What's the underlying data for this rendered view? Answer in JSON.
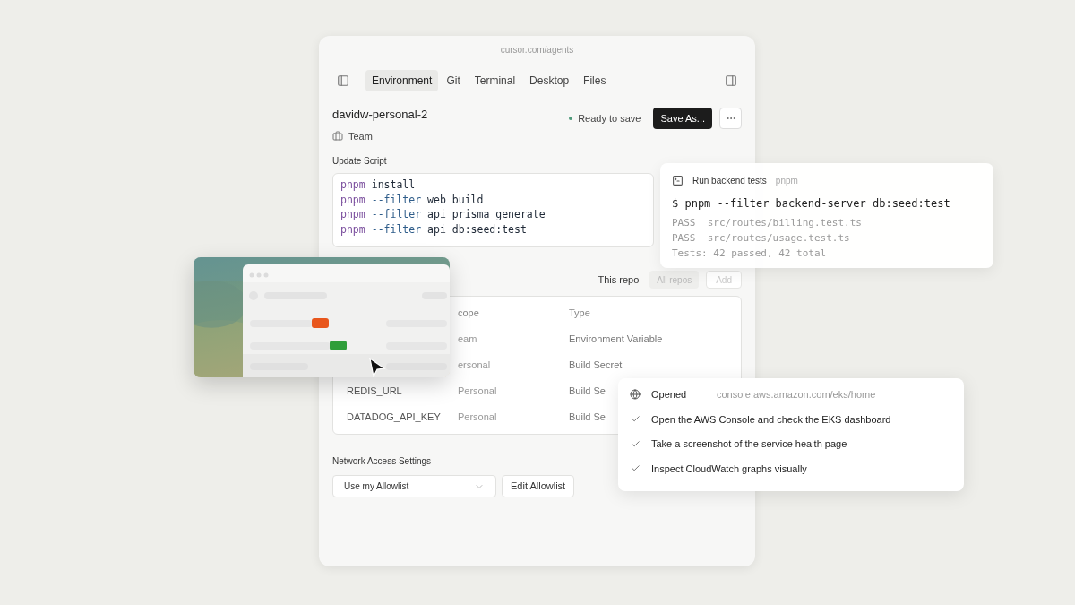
{
  "browser": {
    "url": "cursor.com/agents"
  },
  "tabs": [
    {
      "label": "Environment",
      "selected": true
    },
    {
      "label": "Git",
      "selected": false
    },
    {
      "label": "Terminal",
      "selected": false
    },
    {
      "label": "Desktop",
      "selected": false
    },
    {
      "label": "Files",
      "selected": false
    }
  ],
  "environment": {
    "name": "davidw-personal-2",
    "team": "Team",
    "status": "Ready to save",
    "save_button": "Save As..."
  },
  "update_script": {
    "label": "Update Script",
    "lines": [
      [
        {
          "text": "pnpm",
          "kind": "command"
        },
        {
          "text": "install",
          "kind": "arg"
        }
      ],
      [
        {
          "text": "pnpm",
          "kind": "command"
        },
        {
          "text": "--filter",
          "kind": "flag"
        },
        {
          "text": "web build",
          "kind": "arg"
        }
      ],
      [
        {
          "text": "pnpm",
          "kind": "command"
        },
        {
          "text": "--filter",
          "kind": "flag"
        },
        {
          "text": "api prisma generate",
          "kind": "arg"
        }
      ],
      [
        {
          "text": "pnpm",
          "kind": "command"
        },
        {
          "text": "--filter",
          "kind": "flag"
        },
        {
          "text": "api db:seed:test",
          "kind": "arg"
        }
      ]
    ]
  },
  "secrets": {
    "scope_options": [
      {
        "label": "This repo",
        "selected": true
      },
      {
        "label": "All repos",
        "selected": false
      }
    ],
    "add_button": "Add",
    "columns": [
      "",
      "cope",
      "Type"
    ],
    "rows": [
      {
        "cells": [
          "",
          "eam",
          "Environment Variable"
        ]
      },
      {
        "cells": [
          "",
          "ersonal",
          "Build Secret"
        ]
      },
      {
        "cells": [
          "REDIS_URL",
          "Personal",
          "Build Se"
        ]
      },
      {
        "cells": [
          "DATADOG_API_KEY",
          "Personal",
          "Build Se"
        ]
      }
    ]
  },
  "network": {
    "label": "Network Access Settings",
    "select_value": "Use my Allowlist",
    "edit_button": "Edit Allowlist"
  },
  "terminal_card": {
    "title": "Run backend tests",
    "tag": "pnpm",
    "command": "$ pnpm --filter backend-server db:seed:test",
    "output": [
      "PASS  src/routes/billing.test.ts",
      "PASS  src/routes/usage.test.ts",
      "Tests: 42 passed, 42 total"
    ]
  },
  "browser_card": {
    "action": "Opened",
    "url": "console.aws.amazon.com/eks/home",
    "tasks": [
      {
        "text": "Open the AWS Console and check the EKS dashboard",
        "checked": true
      },
      {
        "text": "Take a screenshot of the service health page",
        "checked": true
      },
      {
        "text": "Inspect CloudWatch graphs visually",
        "checked": true
      }
    ]
  }
}
